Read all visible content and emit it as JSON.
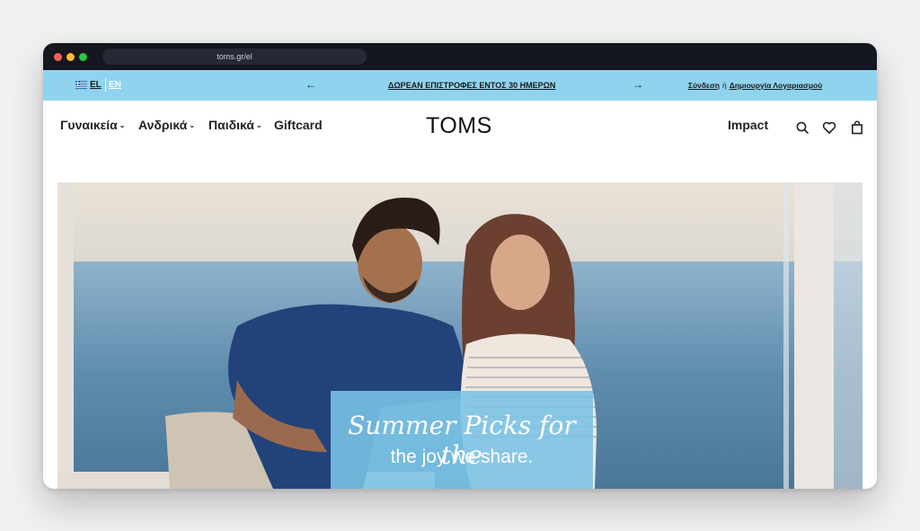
{
  "browser": {
    "url": "toms.gr/el"
  },
  "promo_bar": {
    "lang_el": "EL",
    "lang_en": "EN",
    "prev_arrow": "←",
    "next_arrow": "→",
    "message": "ΔΩΡΕΑΝ ΕΠΙΣΤΡΟΦΕΣ ΕΝΤΟΣ 30 ΗΜΕΡΩΝ",
    "login": "Σύνδεση",
    "or": "ή",
    "register": "Δημιουργία Λογαριασμού",
    "background_color": "#8fd3ee"
  },
  "nav": {
    "items": [
      {
        "label": "Γυναικεία",
        "chevron": "⌄"
      },
      {
        "label": "Ανδρικά",
        "chevron": "⌄"
      },
      {
        "label": "Παιδικά",
        "chevron": "⌄"
      },
      {
        "label": "Giftcard"
      }
    ],
    "logo": "TOMS",
    "impact": "Impact",
    "icons": [
      "search-icon",
      "heart-icon",
      "bag-icon"
    ]
  },
  "hero": {
    "headline_script": "Summer Picks for the",
    "headline_sub": "the joy we share.",
    "caption_color": "#7ac4e6"
  }
}
